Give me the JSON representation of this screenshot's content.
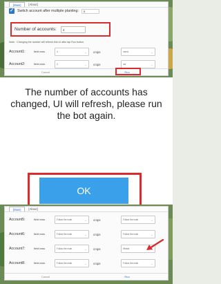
{
  "tabs": {
    "main": "[Main]",
    "about": "[About]"
  },
  "top_panel": {
    "switch_label": "Switch account after multiple planting:",
    "switch_value": "5",
    "num_accounts_label": "Number of accounts:",
    "num_accounts_value": "4",
    "note": "Note：Changing the number will refresh this UI after tap Run button.",
    "accounts": [
      {
        "label": "Account1:",
        "field_label": "field rows",
        "field_value": "4",
        "crops_label": "crops",
        "crops_value": "carrot"
      },
      {
        "label": "Account2:",
        "field_label": "field rows",
        "field_value": "4",
        "crops_label": "crops",
        "crops_value": "car"
      }
    ]
  },
  "bottom_panel": {
    "accounts": [
      {
        "label": "Account5:",
        "field_label": "field rows",
        "field_value": "Follow the main",
        "crops_label": "crops",
        "crops_value": "Follow the main"
      },
      {
        "label": "Account6:",
        "field_label": "field rows",
        "field_value": "Follow the main",
        "crops_label": "crops",
        "crops_value": "Follow the main"
      },
      {
        "label": "Account7:",
        "field_label": "field rows",
        "field_value": "Follow the main",
        "crops_label": "crops",
        "crops_value": "Wheat"
      },
      {
        "label": "Account8:",
        "field_label": "field rows",
        "field_value": "Follow the main",
        "crops_label": "crops",
        "crops_value": "Follow the main"
      }
    ]
  },
  "footer": {
    "cancel": "Cancel",
    "run": "Run"
  },
  "message": {
    "text": "The number of accounts has changed, UI will refresh, please run the bot again.",
    "ok": "OK"
  },
  "colors": {
    "highlight": "#d92d2d",
    "ok_button": "#3aa0ea",
    "accent": "#2f78c9"
  }
}
